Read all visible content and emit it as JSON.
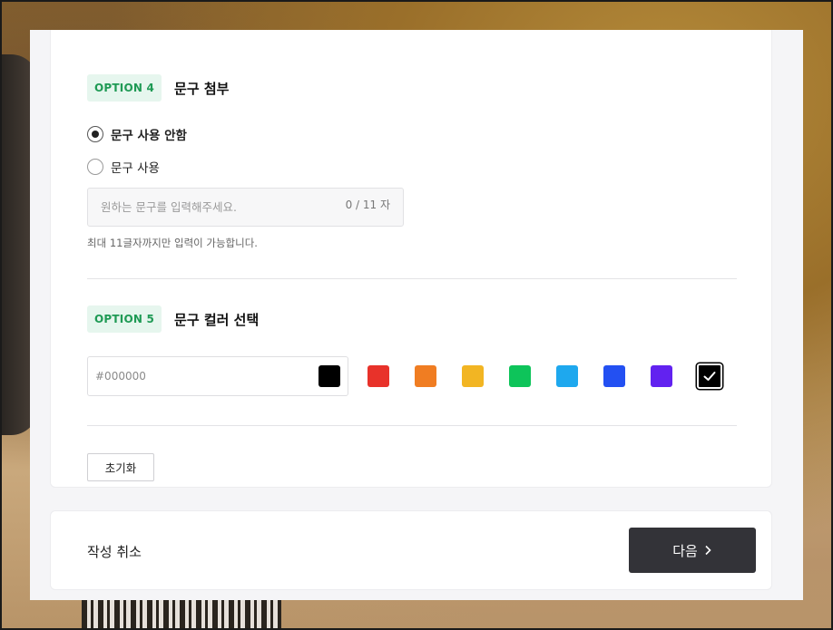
{
  "option4": {
    "badge": "OPTION 4",
    "title": "문구 첨부",
    "radio_no_text": "문구 사용 안함",
    "radio_use_text": "문구 사용",
    "input_placeholder": "원하는 문구를 입력해주세요.",
    "counter": "0 / 11 자",
    "hint": "최대 11글자까지만 입력이 가능합니다.",
    "selected": "no_text"
  },
  "option5": {
    "badge": "OPTION 5",
    "title": "문구 컬러 선택",
    "hex_placeholder": "#000000",
    "hex_preview_color": "#000000",
    "swatches": [
      {
        "name": "red",
        "color": "#e8322a"
      },
      {
        "name": "orange",
        "color": "#f07d22"
      },
      {
        "name": "yellow",
        "color": "#f2b523"
      },
      {
        "name": "green",
        "color": "#0ec45a"
      },
      {
        "name": "sky",
        "color": "#1ea8ee"
      },
      {
        "name": "blue",
        "color": "#2350f2"
      },
      {
        "name": "purple",
        "color": "#6222f0"
      },
      {
        "name": "black",
        "color": "#000000",
        "selected": true
      }
    ]
  },
  "reset_label": "초기화",
  "footer": {
    "cancel_label": "작성 취소",
    "next_label": "다음"
  },
  "colors": {
    "accent_green": "#1f9a55",
    "badge_bg": "#e6f6ee",
    "next_button": "#333338"
  }
}
